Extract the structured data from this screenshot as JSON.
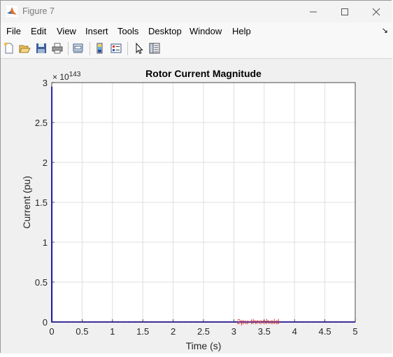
{
  "window": {
    "title": "Figure 7"
  },
  "menu": [
    "File",
    "Edit",
    "View",
    "Insert",
    "Tools",
    "Desktop",
    "Window",
    "Help"
  ],
  "chart_data": {
    "type": "line",
    "title": "Rotor Current Magnitude",
    "xlabel": "Time (s)",
    "ylabel": "Current (pu)",
    "y_exponent_label": "× 10",
    "y_exponent_value": "143",
    "xlim": [
      0,
      5
    ],
    "ylim": [
      0,
      3
    ],
    "xticks": [
      "0",
      "0.5",
      "1",
      "1.5",
      "2",
      "2.5",
      "3",
      "3.5",
      "4",
      "4.5",
      "5"
    ],
    "yticks": [
      "0",
      "0.5",
      "1",
      "1.5",
      "2",
      "2.5",
      "3"
    ],
    "grid": true,
    "series": [
      {
        "color": "#0000ff",
        "x": [
          0,
          0.001,
          0.002,
          5
        ],
        "y": [
          0,
          2.95,
          0,
          0
        ]
      },
      {
        "color": "#ff0000",
        "style": "dashed",
        "x": [
          0,
          5
        ],
        "y": [
          0,
          0
        ]
      }
    ],
    "annotations": [
      {
        "text": "2pu threshold",
        "x": 3.05,
        "y": 0,
        "color": "#e03030"
      }
    ]
  }
}
